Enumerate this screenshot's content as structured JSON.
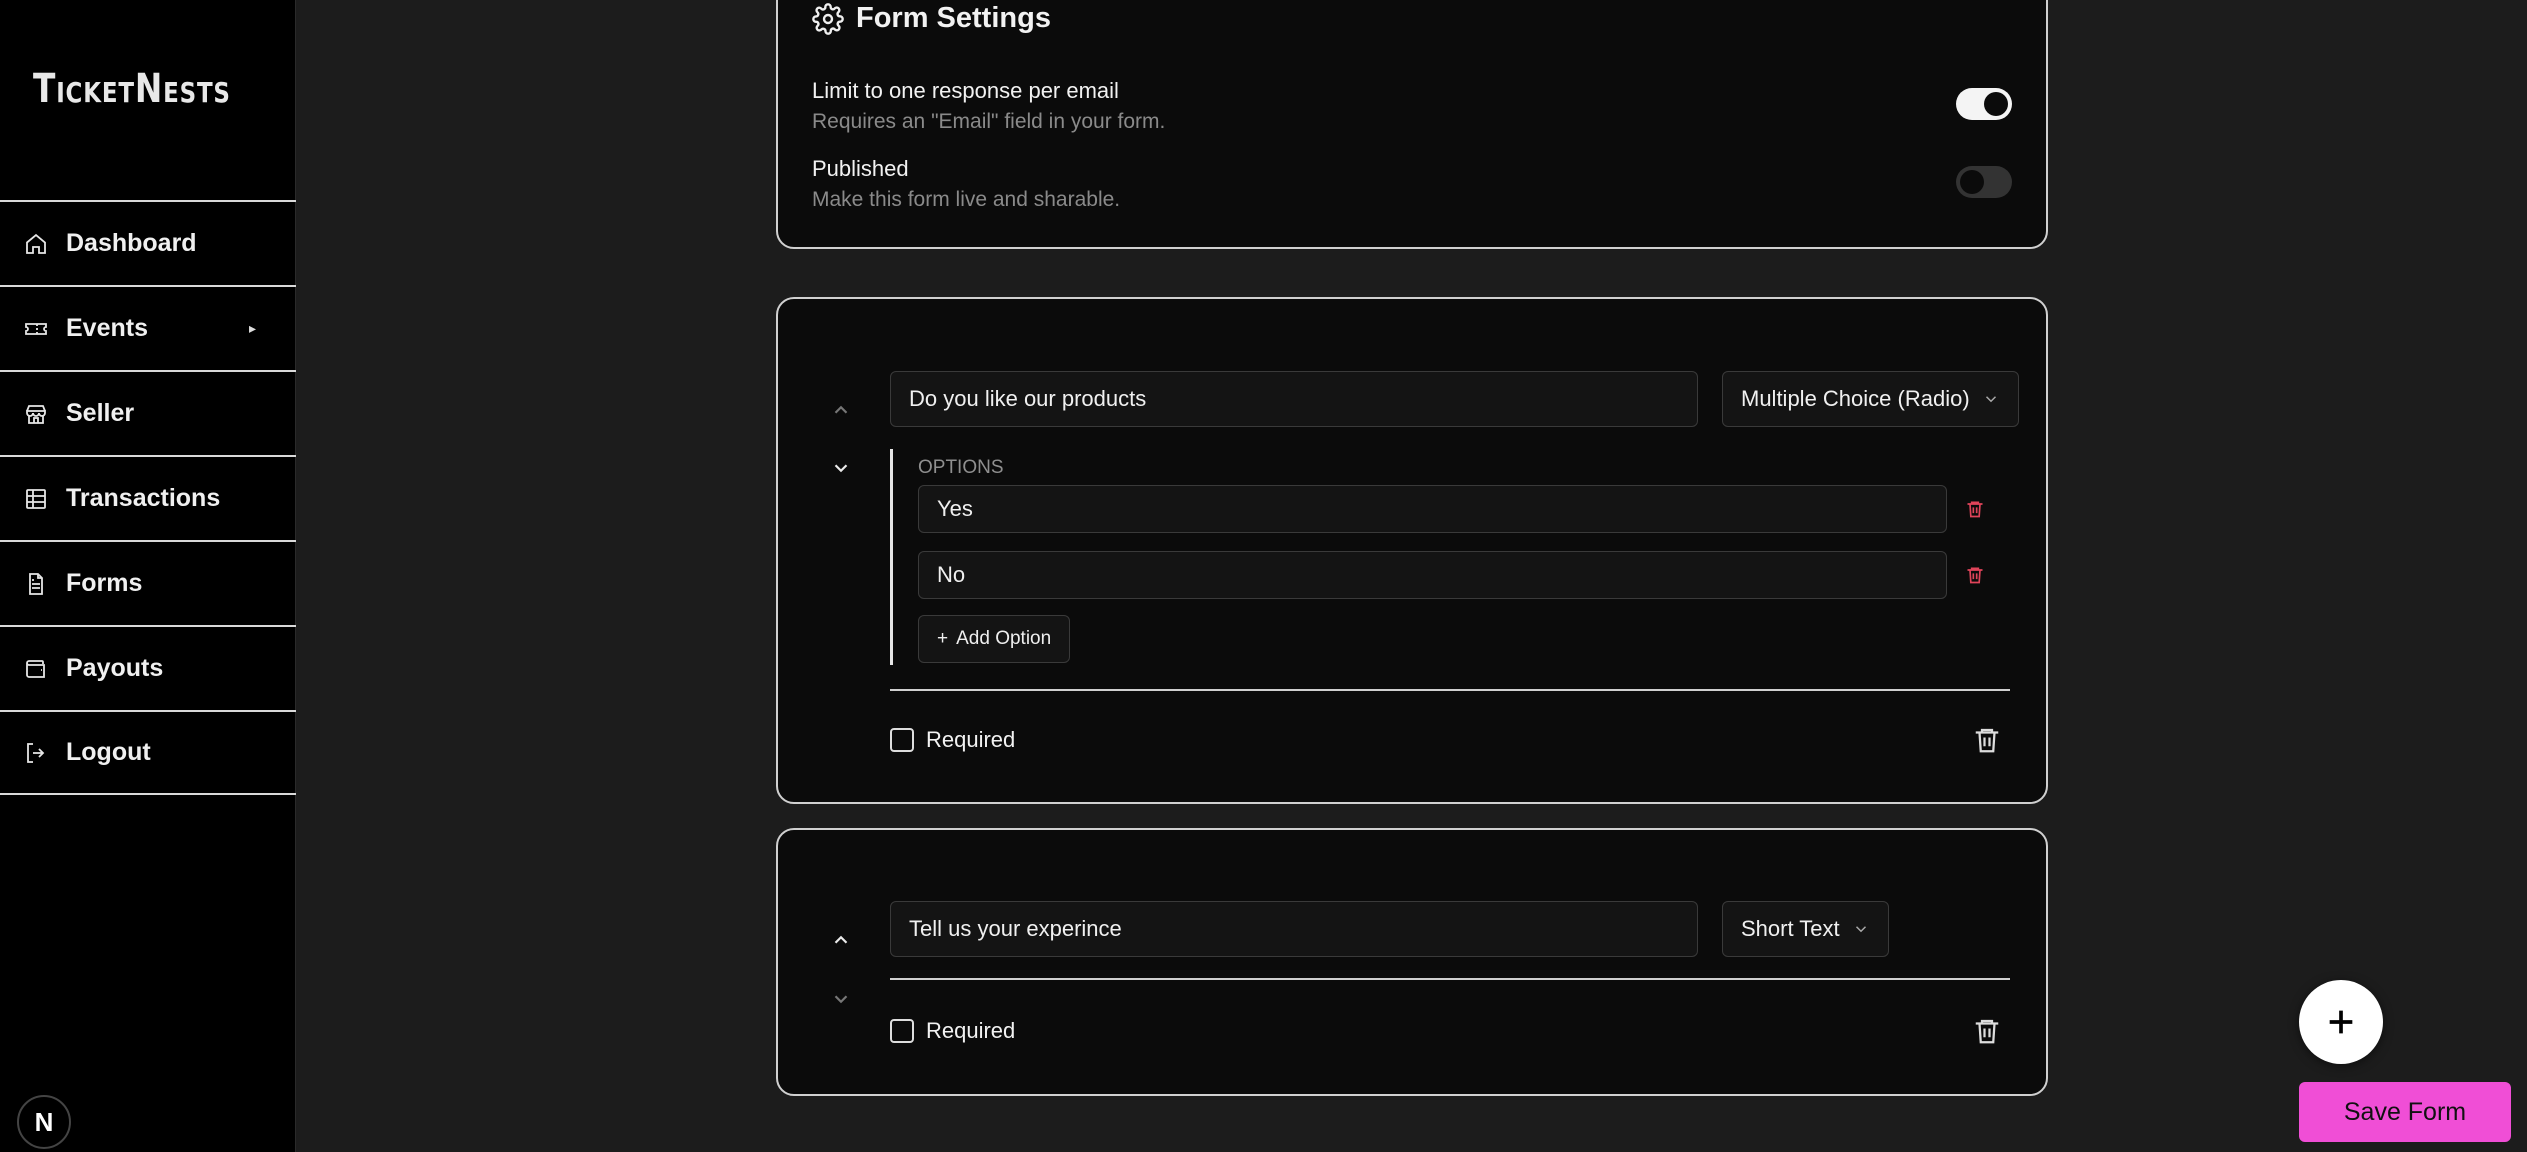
{
  "app": {
    "logo_text": "TicketNests",
    "framework_badge": "N"
  },
  "sidebar": {
    "items": [
      {
        "label": "Dashboard",
        "icon": "home-icon"
      },
      {
        "label": "Events",
        "icon": "ticket-icon",
        "has_submenu": true
      },
      {
        "label": "Seller",
        "icon": "store-icon"
      },
      {
        "label": "Transactions",
        "icon": "table-icon"
      },
      {
        "label": "Forms",
        "icon": "file-text-icon"
      },
      {
        "label": "Payouts",
        "icon": "wallet-icon"
      },
      {
        "label": "Logout",
        "icon": "log-out-icon"
      }
    ],
    "submenu_arrow": "▸"
  },
  "form_settings": {
    "title": "Form Settings",
    "limit_one_response": {
      "label": "Limit to one response per email",
      "description": "Requires an \"Email\" field in your form.",
      "enabled": true
    },
    "published": {
      "label": "Published",
      "description": "Make this form live and sharable.",
      "enabled": false
    }
  },
  "questions": [
    {
      "title": "Do you like our products",
      "type": "Multiple Choice (Radio)",
      "options_label": "OPTIONS",
      "options": [
        "Yes",
        "No"
      ],
      "add_option_label": "Add Option",
      "required_label": "Required",
      "required": false
    },
    {
      "title": "Tell us your experince",
      "type": "Short Text",
      "required_label": "Required",
      "required": false
    }
  ],
  "actions": {
    "save_label": "Save Form",
    "add_question_icon": "plus-icon"
  },
  "colors": {
    "accent": "#f04ed6",
    "danger": "#e0445a",
    "background": "#1c1c1c",
    "card": "#0b0b0b"
  }
}
